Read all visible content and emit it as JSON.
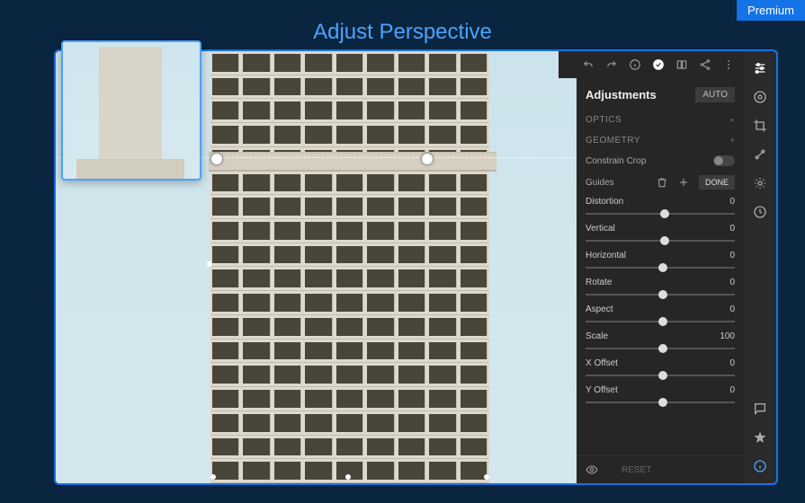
{
  "premium_label": "Premium",
  "title": "Adjust Perspective",
  "topIcons": {
    "undo": "undo-icon",
    "redo": "redo-icon",
    "info": "info-icon",
    "confirm": "confirm-icon",
    "compare": "compare-icon",
    "share": "share-icon",
    "menu": "menu-icon"
  },
  "panel": {
    "header": "Adjustments",
    "auto": "AUTO",
    "section_optics": "OPTICS",
    "section_geometry": "GEOMETRY",
    "constrain_label": "Constrain Crop",
    "constrain_on": false,
    "guides_label": "Guides",
    "done_label": "DONE",
    "sliders": [
      {
        "label": "Distortion",
        "value": "0",
        "pos": 50
      },
      {
        "label": "Vertical",
        "value": "0",
        "pos": 50
      },
      {
        "label": "Horizontal",
        "value": "0",
        "pos": 49
      },
      {
        "label": "Rotate",
        "value": "0",
        "pos": 49
      },
      {
        "label": "Aspect",
        "value": "0",
        "pos": 49
      },
      {
        "label": "Scale",
        "value": "100",
        "pos": 49
      },
      {
        "label": "X Offset",
        "value": "0",
        "pos": 49
      },
      {
        "label": "Y Offset",
        "value": "0",
        "pos": 49
      }
    ],
    "reset_label": "RESET"
  },
  "rightTools": [
    "adjust-icon",
    "color-icon",
    "crop-icon",
    "heal-icon",
    "preset-icon",
    "history-icon"
  ],
  "bottomTools": [
    "comment-icon",
    "star-icon",
    "info-icon"
  ]
}
